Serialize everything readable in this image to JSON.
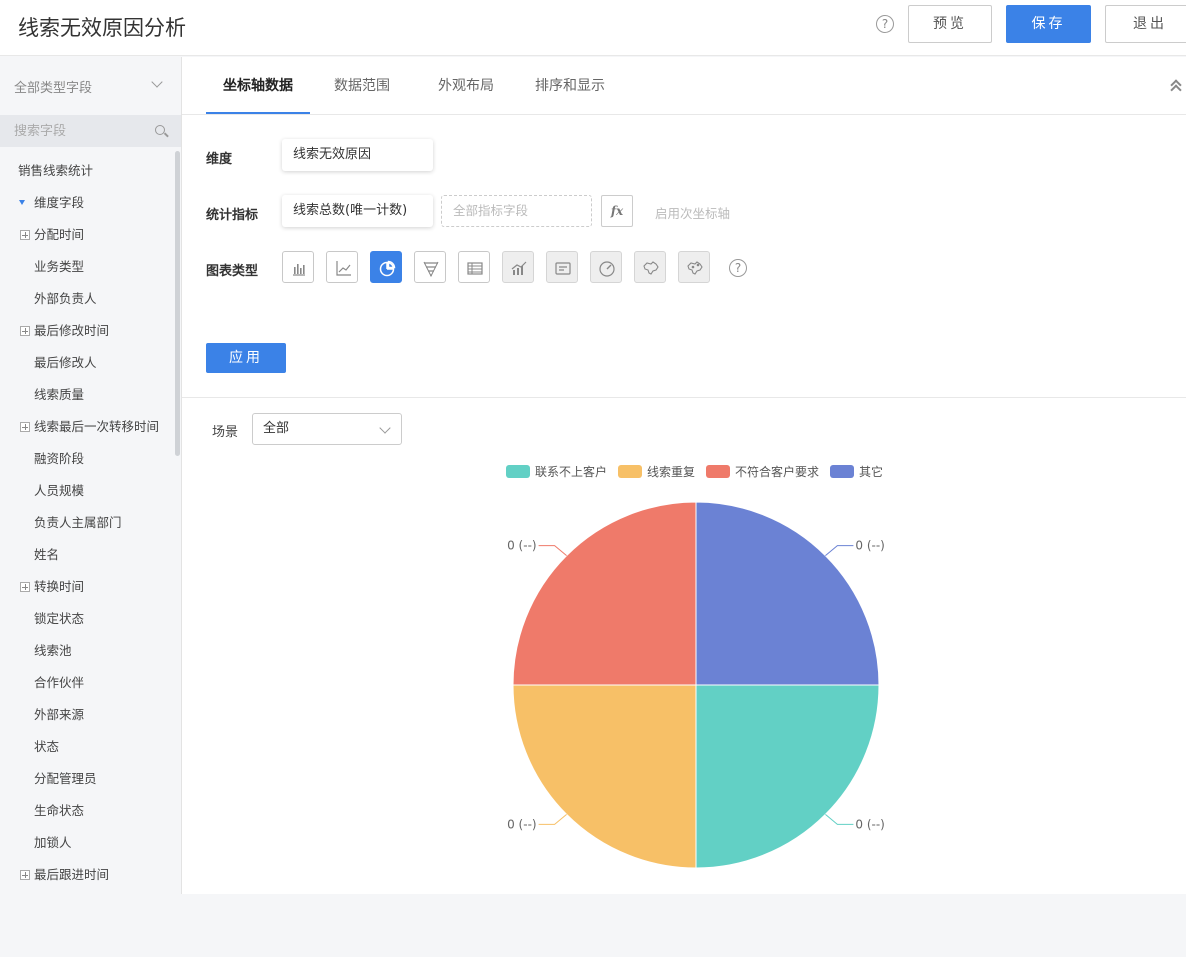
{
  "header": {
    "title": "线索无效原因分析",
    "help": "?",
    "preview_label": "预览",
    "save_label": "保存",
    "exit_label": "退出"
  },
  "sidebar": {
    "type_select": "全部类型字段",
    "search_placeholder": "搜索字段",
    "items": [
      {
        "label": "销售线索统计",
        "kind": "group"
      },
      {
        "label": "维度字段",
        "kind": "parent-open"
      },
      {
        "label": "分配时间",
        "kind": "parent"
      },
      {
        "label": "业务类型",
        "kind": "sub"
      },
      {
        "label": "外部负责人",
        "kind": "sub"
      },
      {
        "label": "最后修改时间",
        "kind": "parent"
      },
      {
        "label": "最后修改人",
        "kind": "sub"
      },
      {
        "label": "线索质量",
        "kind": "sub"
      },
      {
        "label": "线索最后一次转移时间",
        "kind": "parent"
      },
      {
        "label": "融资阶段",
        "kind": "sub"
      },
      {
        "label": "人员规模",
        "kind": "sub"
      },
      {
        "label": "负责人主属部门",
        "kind": "sub"
      },
      {
        "label": "姓名",
        "kind": "sub"
      },
      {
        "label": "转换时间",
        "kind": "parent"
      },
      {
        "label": "锁定状态",
        "kind": "sub"
      },
      {
        "label": "线索池",
        "kind": "sub"
      },
      {
        "label": "合作伙伴",
        "kind": "sub"
      },
      {
        "label": "外部来源",
        "kind": "sub"
      },
      {
        "label": "状态",
        "kind": "sub"
      },
      {
        "label": "分配管理员",
        "kind": "sub"
      },
      {
        "label": "生命状态",
        "kind": "sub"
      },
      {
        "label": "加锁人",
        "kind": "sub"
      },
      {
        "label": "最后跟进时间",
        "kind": "parent"
      }
    ]
  },
  "tabs": [
    {
      "label": "坐标轴数据",
      "active": true
    },
    {
      "label": "数据范围",
      "active": false
    },
    {
      "label": "外观布局",
      "active": false
    },
    {
      "label": "排序和显示",
      "active": false
    }
  ],
  "form": {
    "dimension_label": "维度",
    "dimension_value": "线索无效原因",
    "metric_label": "统计指标",
    "metric_value": "线索总数(唯一计数)",
    "metric_placeholder": "全部指标字段",
    "fx_label": "fx",
    "secondary_axis_label": "启用次坐标轴",
    "chart_type_label": "图表类型",
    "chart_types": [
      {
        "icon": "bar-chart-icon",
        "state": "normal"
      },
      {
        "icon": "line-chart-icon",
        "state": "normal"
      },
      {
        "icon": "pie-chart-icon",
        "state": "active"
      },
      {
        "icon": "funnel-chart-icon",
        "state": "normal"
      },
      {
        "icon": "table-chart-icon",
        "state": "normal"
      },
      {
        "icon": "combo-chart-icon",
        "state": "disabled"
      },
      {
        "icon": "card-chart-icon",
        "state": "disabled"
      },
      {
        "icon": "gauge-chart-icon",
        "state": "disabled"
      },
      {
        "icon": "map-chart-icon",
        "state": "disabled"
      },
      {
        "icon": "scatter-map-icon",
        "state": "disabled"
      }
    ],
    "chart_type_help": "?",
    "apply_label": "应用"
  },
  "scene": {
    "label": "场景",
    "value": "全部"
  },
  "colors": {
    "accent": "#3b82e7"
  },
  "chart_data": {
    "type": "pie",
    "categories": [
      "联系不上客户",
      "线索重复",
      "不符合客户要求",
      "其它"
    ],
    "values": [
      0,
      0,
      0,
      0
    ],
    "shares": [
      0.25,
      0.25,
      0.25,
      0.25
    ],
    "labels": [
      "0 (--)",
      "0 (--)",
      "0 (--)",
      "0 (--)"
    ],
    "colors": [
      "#62d0c5",
      "#f7c067",
      "#ef7a6a",
      "#6b82d4"
    ],
    "legend_position": "top"
  }
}
